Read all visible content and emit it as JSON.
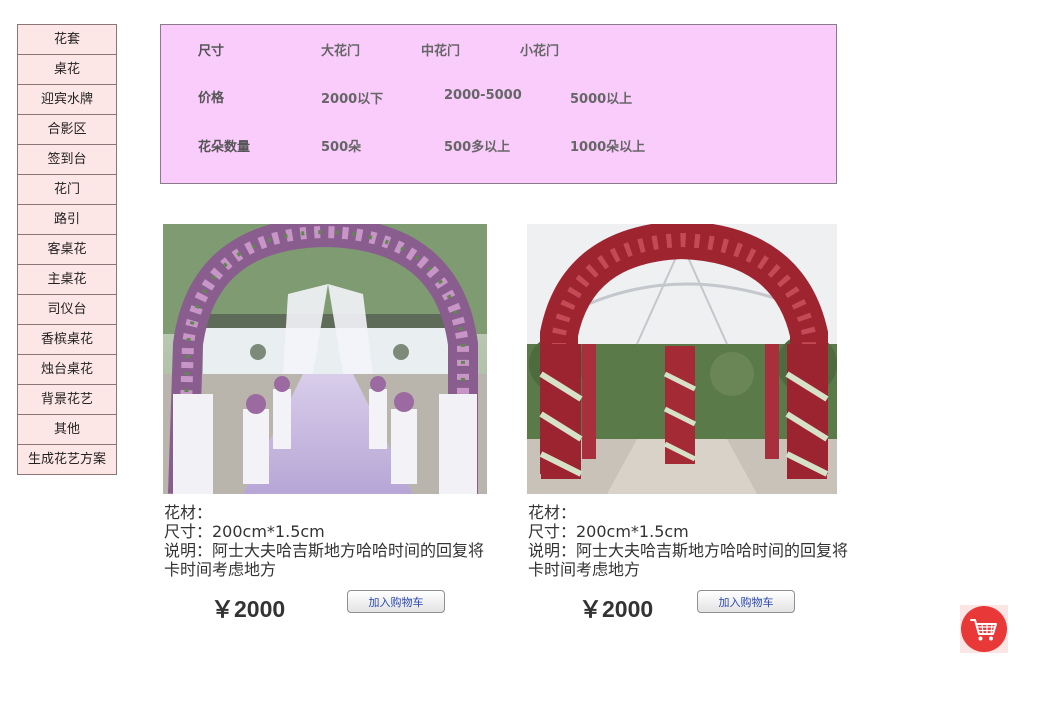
{
  "sidebar": {
    "items": [
      {
        "label": "花套"
      },
      {
        "label": "桌花"
      },
      {
        "label": "迎宾水牌"
      },
      {
        "label": "合影区"
      },
      {
        "label": "签到台"
      },
      {
        "label": "花门"
      },
      {
        "label": "路引"
      },
      {
        "label": "客桌花"
      },
      {
        "label": "主桌花"
      },
      {
        "label": "司仪台"
      },
      {
        "label": "香槟桌花"
      },
      {
        "label": "烛台桌花"
      },
      {
        "label": "背景花艺"
      },
      {
        "label": "其他"
      },
      {
        "label": "生成花艺方案"
      }
    ]
  },
  "filters": {
    "size": {
      "label": "尺寸",
      "options": [
        "大花门",
        "中花门",
        "小花门"
      ]
    },
    "price": {
      "label": "价格",
      "options": [
        "2000以下",
        "2000-5000",
        "5000以上"
      ]
    },
    "count": {
      "label": "花朵数量",
      "options": [
        "500朵",
        "500多以上",
        "1000朵以上"
      ]
    }
  },
  "products": [
    {
      "material": "花材：",
      "size": "尺寸：200cm*1.5cm",
      "description": "说明：阿士大夫哈吉斯地方哈哈时间的回复将卡时间考虑地方",
      "price": "￥2000",
      "cart_label": "加入购物车",
      "image_icon": "flower-arch-aisle-photo"
    },
    {
      "material": "花材：",
      "size": "尺寸：200cm*1.5cm",
      "description": "说明：阿士大夫哈吉斯地方哈哈时间的回复将卡时间考虑地方",
      "price": "￥2000",
      "cart_label": "加入购物车",
      "image_icon": "red-flower-arch-photo"
    }
  ],
  "floating_cart": {
    "icon": "shopping-cart-icon",
    "color": "#e83838"
  },
  "colors": {
    "sidebar_bg": "#fde6e6",
    "filter_bg": "#f9ccfc",
    "cart_button_text": "#2a48b0"
  }
}
